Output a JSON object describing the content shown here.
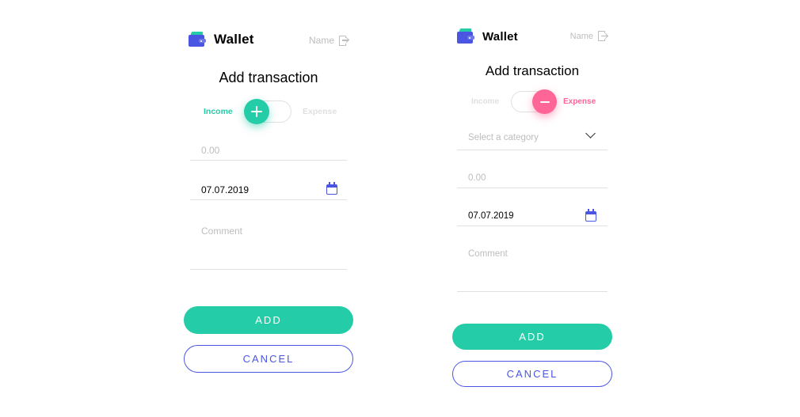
{
  "colors": {
    "accent_income": "#24cca7",
    "accent_expense": "#ff6596",
    "brand_blue": "#4a56e2",
    "placeholder": "#bdbdbd"
  },
  "screens": [
    {
      "id": "income",
      "header": {
        "brand": "Wallet",
        "user_name": "Name",
        "logo_icon": "wallet-icon",
        "exit_icon": "exit-icon"
      },
      "title": "Add transaction",
      "toggle": {
        "income_label": "Income",
        "expense_label": "Expense",
        "state": "income",
        "knob_icon": "plus-icon"
      },
      "amount": {
        "placeholder": "0.00",
        "value": ""
      },
      "date": {
        "value": "07.07.2019",
        "icon": "calendar-icon"
      },
      "comment": {
        "placeholder": "Comment",
        "value": ""
      },
      "buttons": {
        "add": "ADD",
        "cancel": "CANCEL"
      }
    },
    {
      "id": "expense",
      "header": {
        "brand": "Wallet",
        "user_name": "Name",
        "logo_icon": "wallet-icon",
        "exit_icon": "exit-icon"
      },
      "title": "Add transaction",
      "toggle": {
        "income_label": "Income",
        "expense_label": "Expense",
        "state": "expense",
        "knob_icon": "minus-icon"
      },
      "category": {
        "placeholder": "Select a category",
        "icon": "chevron-down-icon"
      },
      "amount": {
        "placeholder": "0.00",
        "value": ""
      },
      "date": {
        "value": "07.07.2019",
        "icon": "calendar-icon"
      },
      "comment": {
        "placeholder": "Comment",
        "value": ""
      },
      "buttons": {
        "add": "ADD",
        "cancel": "CANCEL"
      }
    }
  ]
}
